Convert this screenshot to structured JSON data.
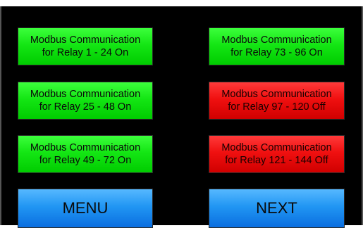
{
  "colors": {
    "on": "#00dd00",
    "off": "#ee0000",
    "nav": "#2196f3",
    "background": "#000000"
  },
  "relays": [
    {
      "line1": "Modbus Communication",
      "line2": "for Relay 1 - 24 On",
      "state": "on"
    },
    {
      "line1": "Modbus Communication",
      "line2": "for Relay 25 - 48 On",
      "state": "on"
    },
    {
      "line1": "Modbus Communication",
      "line2": "for Relay 49 - 72 On",
      "state": "on"
    },
    {
      "line1": "Modbus Communication",
      "line2": "for Relay 73 - 96 On",
      "state": "on"
    },
    {
      "line1": "Modbus Communication",
      "line2": "for Relay 97 - 120 Off",
      "state": "off"
    },
    {
      "line1": "Modbus Communication",
      "line2": "for Relay 121 - 144 Off",
      "state": "off"
    }
  ],
  "nav": {
    "menu_label": "MENU",
    "next_label": "NEXT"
  }
}
